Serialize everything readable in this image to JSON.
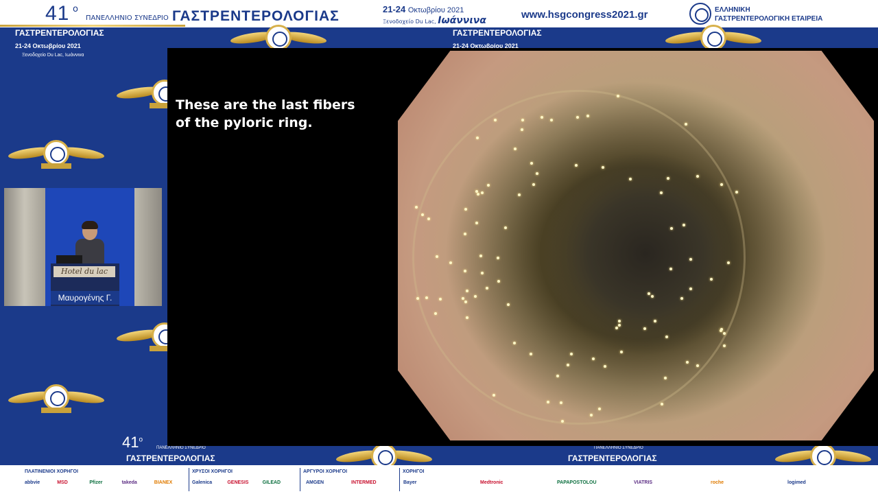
{
  "header": {
    "number": "41",
    "superscript": "ο",
    "conference_small": "ΠΑΝΕΛΛΗΝΙΟ ΣΥΝΕΔΡΙΟ",
    "conference_big": "ΓΑΣΤΡΕΝΤΕΡΟΛΟΓΙΑΣ",
    "dates_bold": "21-24",
    "dates_rest": "Οκτωβρίου 2021",
    "venue_small": "Ξενοδοχείο Du Lac,",
    "venue_city": "Ιωάννινα",
    "url": "www.hsgcongress2021.gr",
    "society_line1": "ΕΛΛΗΝΙΚΗ",
    "society_line2": "ΓΑΣΤΡΕΝΤΕΡΟΛΟΓΙΚΗ ΕΤΑΙΡΕΙΑ"
  },
  "background": {
    "title_left": "ΓΑΣΤΡΕΝΤΕΡΟΛΟΓΙΑΣ",
    "dates_left": "21-24 Οκτωβρίου 2021",
    "venue_left": "Ξενοδοχείο Du Lac, Ιωάννινα",
    "title_center": "ΓΑΣΤΡΕΝΤΕΡΟΛΟΓΙΑΣ",
    "dates_center": "21-24 Οκτωβρίου 2021",
    "bottom_number": "41",
    "bottom_sup": "ο",
    "bottom_small": "ΠΑΝΕΛΛΗΝΙΟ ΣΥΝΕΔΡΙΟ",
    "bottom_title": "ΓΑΣΤΡΕΝΤΕΡΟΛΟΓΙΑΣ",
    "bottom_small_right": "ΠΑΝΕΛΛΗΝΙΟ ΣΥΝΕΔΡΙΟ",
    "bottom_title_right": "ΓΑΣΤΡΕΝΤΕΡΟΛΟΓΙΑΣ"
  },
  "video": {
    "caption_line1": "These are the last fibers",
    "caption_line2": "of the pyloric ring."
  },
  "speaker": {
    "podium_sign": "Hotel du lac",
    "name": "Μαυρογένης Γ."
  },
  "sponsors": {
    "platinum_title": "ΠΛΑΤΙΝΕΝΙΟΙ ΧΟΡΗΓΟΙ",
    "gold_title": "ΧΡΥΣΟΙ ΧΟΡΗΓΟΙ",
    "silver_title": "ΑΡΓΥΡΟΙ ΧΟΡΗΓΟΙ",
    "sponsors_title": "ΧΟΡΗΓΟΙ",
    "platinum": [
      "abbvie",
      "MSD",
      "Pfizer",
      "takeda",
      "BIANEX"
    ],
    "gold": [
      "Galenica",
      "GENESIS",
      "GILEAD"
    ],
    "silver": [
      "AMGEN",
      "INTERMED"
    ],
    "others": [
      "Bayer",
      "Medtronic",
      "PAPAPOSTOLOU",
      "VIATRIS",
      "roche",
      "logimed"
    ]
  },
  "colors": {
    "brand_blue": "#1b3a8a",
    "gold": "#c9a23b",
    "caption_text": "#ffffff"
  }
}
